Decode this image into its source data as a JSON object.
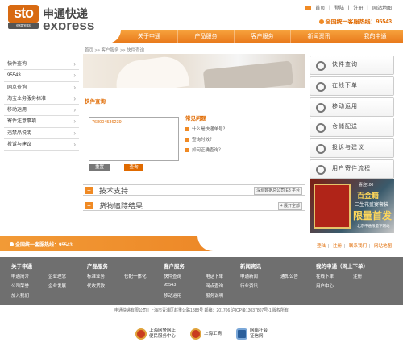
{
  "brand": {
    "badge": "sto",
    "badge_sub": "express",
    "name_cn": "申通快递",
    "name_en": "express"
  },
  "top_links": [
    "首页",
    "登陆",
    "注册",
    "网站地图"
  ],
  "hotline": "全国统一客服热线：95543",
  "nav": [
    "关于申通",
    "产品服务",
    "客户服务",
    "新闻资讯",
    "我的申通"
  ],
  "breadcrumb": "首页 >> 客户服务 >> 快件查询",
  "sidebar": [
    "快件查询",
    "95543",
    "网点查询",
    "淘宝业务服务标准",
    "移动运用",
    "寄件注意事项",
    "违禁品说明",
    "投诉与建议"
  ],
  "query": {
    "title": "快件查询",
    "input_value": "768004536239",
    "reset_label": "重置",
    "query_label": "查询"
  },
  "faq": {
    "title": "常见问题",
    "items": [
      "什么是快递单号？",
      "查询时效？",
      "如何正确查询？"
    ]
  },
  "support": {
    "tech_label": "技术支持",
    "tech_right": "深圳数据总公司 E3 平台",
    "track_label": "货物追踪结果",
    "track_right": "+ 展开全部"
  },
  "right_menu": [
    "快件查询",
    "在线下单",
    "移动运用",
    "仓储配送",
    "投诉与建议",
    "用户寄件流程"
  ],
  "ad": {
    "t1": "喜迎100",
    "t2": "百金籍",
    "t3": "三生花盛宴套装",
    "t4": "限量首发",
    "t5": "北京申通限量下网站"
  },
  "footer_bar": {
    "hotline": "全国统一客服热线：95543",
    "links": [
      "登陆",
      "注册",
      "联系我们",
      "网站地图"
    ]
  },
  "footer": {
    "columns": [
      {
        "title": "关于申通",
        "items": [
          "申通简介",
          "企业理念",
          "公司荣誉",
          "企业发展",
          "加入我们",
          ""
        ]
      },
      {
        "title": "产品服务",
        "items": [
          "标准业务",
          "仓配一体化",
          "代收货款",
          ""
        ]
      },
      {
        "title": "客户服务",
        "items": [
          "快件查询",
          "电话下单",
          "95543",
          "网点查询",
          "移动运用",
          "服务说明"
        ]
      },
      {
        "title": "新闻资讯",
        "items": [
          "申通新闻",
          "通知公告",
          "行业资讯",
          ""
        ]
      },
      {
        "title": "我的申通（网上下单）",
        "items": [
          "在线下单",
          "注册",
          "用户中心",
          ""
        ]
      }
    ]
  },
  "copyright": "申通快递有限公司   |   上海市青浦区赵重公路1888号 邮编：201706 沪ICP备13037807号-1 版权所有",
  "badges": [
    {
      "label": "上海网警网上\n便民服务中心"
    },
    {
      "label": "上海工商"
    },
    {
      "label": "网络社会\n证信网"
    }
  ]
}
